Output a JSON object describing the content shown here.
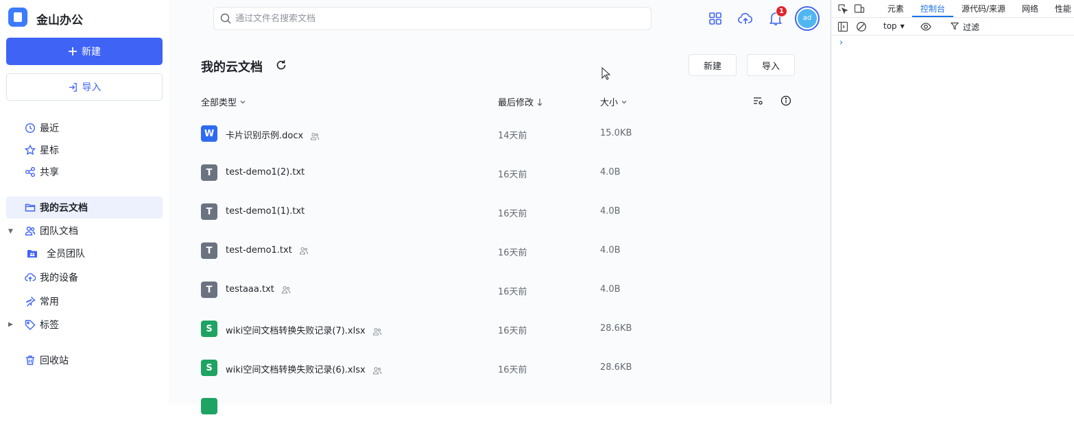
{
  "app": {
    "name": "金山办公"
  },
  "sidebar": {
    "new_label": "新建",
    "import_label": "导入",
    "items": [
      {
        "label": "最近",
        "icon": "clock-icon"
      },
      {
        "label": "星标",
        "icon": "star-icon"
      },
      {
        "label": "共享",
        "icon": "share-icon"
      },
      {
        "label": "我的云文档",
        "icon": "folder-icon"
      },
      {
        "label": "团队文档",
        "icon": "team-icon"
      },
      {
        "label": "全员团队",
        "icon": "team-folder-icon"
      },
      {
        "label": "我的设备",
        "icon": "cloud-upload-icon"
      },
      {
        "label": "常用",
        "icon": "pin-icon"
      },
      {
        "label": "标签",
        "icon": "tag-icon"
      },
      {
        "label": "回收站",
        "icon": "trash-icon"
      }
    ]
  },
  "header": {
    "search_placeholder": "通过文件名搜索文档",
    "notification_count": "1",
    "avatar_text": "ad"
  },
  "main": {
    "title": "我的云文档",
    "new_button": "新建",
    "import_button": "导入",
    "columns": {
      "type": "全部类型",
      "modified": "最后修改",
      "size": "大小"
    },
    "files": [
      {
        "name": "卡片识别示例.docx",
        "time": "14天前",
        "size": "15.0KB",
        "kind": "W",
        "shared": true
      },
      {
        "name": "test-demo1(2).txt",
        "time": "16天前",
        "size": "4.0B",
        "kind": "T",
        "shared": false
      },
      {
        "name": "test-demo1(1).txt",
        "time": "16天前",
        "size": "4.0B",
        "kind": "T",
        "shared": false
      },
      {
        "name": "test-demo1.txt",
        "time": "16天前",
        "size": "4.0B",
        "kind": "T",
        "shared": true
      },
      {
        "name": "testaaa.txt",
        "time": "16天前",
        "size": "4.0B",
        "kind": "T",
        "shared": true
      },
      {
        "name": "wiki空间文档转换失败记录(7).xlsx",
        "time": "16天前",
        "size": "28.6KB",
        "kind": "S",
        "shared": true
      },
      {
        "name": "wiki空间文档转换失败记录(6).xlsx",
        "time": "16天前",
        "size": "28.6KB",
        "kind": "S",
        "shared": true
      }
    ],
    "colors": {
      "W": "#2f6bf0",
      "T": "#6b7280",
      "S": "#1ea362"
    }
  },
  "devtools": {
    "tabs": [
      "元素",
      "控制台",
      "源代码/来源",
      "网络",
      "性能"
    ],
    "active_tab": "控制台",
    "context": "top",
    "filter_label": "过滤",
    "prompt": "›"
  }
}
